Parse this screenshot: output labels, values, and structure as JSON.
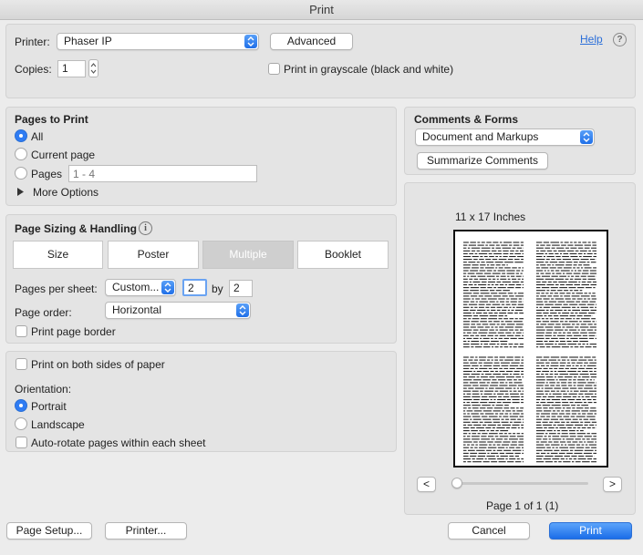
{
  "window": {
    "title": "Print"
  },
  "printer": {
    "label": "Printer:",
    "value": "Phaser IP",
    "advanced_label": "Advanced",
    "help_label": "Help",
    "help_icon": "?"
  },
  "copies": {
    "label": "Copies:",
    "value": "1",
    "grayscale_label": "Print in grayscale (black and white)",
    "grayscale_checked": false
  },
  "pages_to_print": {
    "title": "Pages to Print",
    "options": [
      {
        "label": "All",
        "selected": true
      },
      {
        "label": "Current page",
        "selected": false
      },
      {
        "label": "Pages",
        "selected": false
      }
    ],
    "pages_placeholder": "1 - 4",
    "more_options_label": "More Options"
  },
  "comments_forms": {
    "title": "Comments & Forms",
    "value": "Document and Markups",
    "summarize_label": "Summarize Comments"
  },
  "page_sizing": {
    "title": "Page Sizing & Handling",
    "info_icon": "i",
    "tabs": [
      {
        "label": "Size",
        "active": false
      },
      {
        "label": "Poster",
        "active": false
      },
      {
        "label": "Multiple",
        "active": true
      },
      {
        "label": "Booklet",
        "active": false
      }
    ],
    "pages_per_sheet_label": "Pages per sheet:",
    "pages_per_sheet_value": "Custom...",
    "cols": "2",
    "by_label": "by",
    "rows": "2",
    "page_order_label": "Page order:",
    "page_order_value": "Horizontal",
    "border_label": "Print page border",
    "border_checked": false
  },
  "duplex": {
    "both_sides_label": "Print on both sides of paper",
    "both_sides_checked": false,
    "orientation_label": "Orientation:",
    "orientations": [
      {
        "label": "Portrait",
        "selected": true
      },
      {
        "label": "Landscape",
        "selected": false
      }
    ],
    "autorotate_label": "Auto-rotate pages within each sheet",
    "autorotate_checked": false
  },
  "preview": {
    "paper_size": "11 x 17 Inches",
    "prev_label": "<",
    "next_label": ">",
    "page_indicator": "Page 1 of 1 (1)",
    "slider_position": 0
  },
  "footer": {
    "page_setup_label": "Page Setup...",
    "printer_label": "Printer...",
    "cancel_label": "Cancel",
    "print_label": "Print"
  },
  "colors": {
    "accent": "#2f7cf3",
    "primary_button": "#1b6de8",
    "link": "#2b6fd9"
  },
  "icons": {
    "popup": "chevron-updown-icon",
    "disclosure": "triangle-right-icon",
    "info": "info-circle-icon",
    "help": "question-circle-icon"
  }
}
